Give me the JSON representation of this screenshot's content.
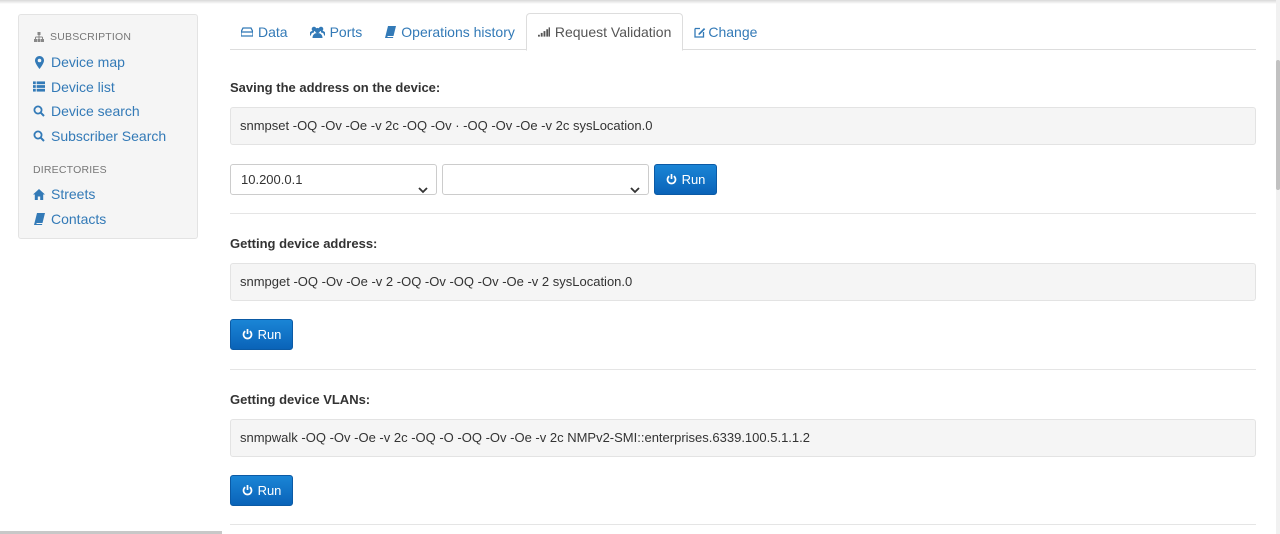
{
  "sidebar": {
    "header1": "SUBSCRIPTION",
    "items1": [
      {
        "label": "Device map",
        "icon": "map-marker-icon"
      },
      {
        "label": "Device list",
        "icon": "list-icon"
      },
      {
        "label": "Device search",
        "icon": "search-icon"
      },
      {
        "label": "Subscriber Search",
        "icon": "search-icon"
      }
    ],
    "header2": "DIRECTORIES",
    "items2": [
      {
        "label": "Streets",
        "icon": "home-icon"
      },
      {
        "label": "Contacts",
        "icon": "book-icon"
      }
    ]
  },
  "tabs": [
    {
      "label": "Data",
      "icon": "hdd-icon"
    },
    {
      "label": "Ports",
      "icon": "users-icon"
    },
    {
      "label": "Operations history",
      "icon": "book-icon"
    },
    {
      "label": "Request Validation",
      "icon": "signal-icon"
    },
    {
      "label": "Change",
      "icon": "edit-icon"
    }
  ],
  "active_tab": "Request Validation",
  "sections": [
    {
      "title": "Saving the address on the device:",
      "command": "snmpset -OQ -Ov -Oe -v 2c  -OQ -Ov · -OQ -Ov -Oe -v 2c sysLocation.0",
      "select1_value": "10.200.0.1",
      "select2_value": "",
      "run_label": "Run"
    },
    {
      "title": "Getting device address:",
      "command": "snmpget -OQ -Ov -Oe -v 2 -OQ -Ov -OQ -Ov -Oe -v 2 sysLocation.0",
      "run_label": "Run"
    },
    {
      "title": "Getting device VLANs:",
      "command": "snmpwalk -OQ -Ov -Oe -v 2c -OQ -O -OQ -Ov -Oe -v 2c NMPv2-SMI::enterprises.6339.100.5.1.1.2",
      "run_label": "Run"
    }
  ],
  "colors": {
    "link": "#337ab7",
    "button": "#0a6ec4"
  }
}
